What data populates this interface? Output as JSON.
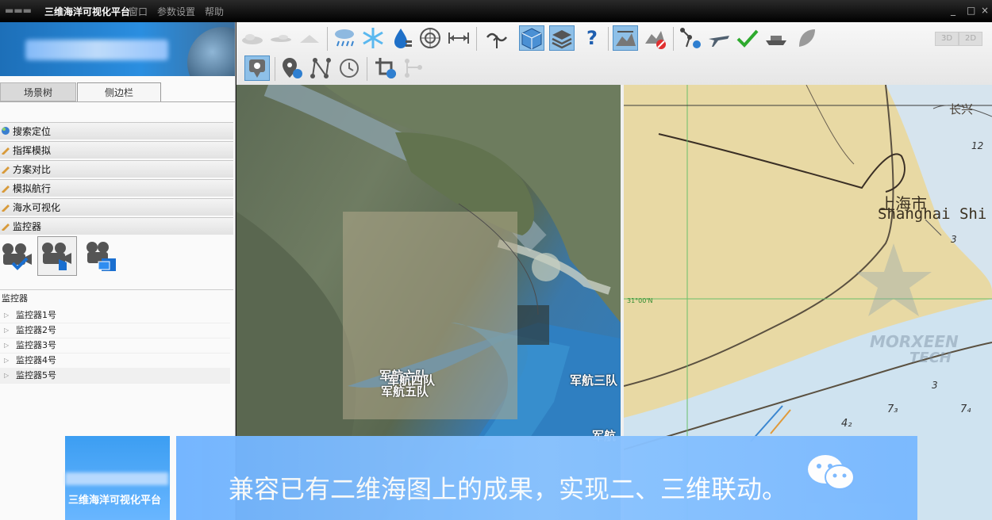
{
  "window": {
    "title": "三维海洋可视化平台",
    "menu": [
      "窗口",
      "参数设置",
      "帮助"
    ],
    "controls": [
      "_",
      "□",
      "×"
    ]
  },
  "sidebar": {
    "tabs": [
      "场景树",
      "侧边栏"
    ],
    "menu_items": [
      {
        "label": "搜索定位",
        "icon": "globe-search-icon"
      },
      {
        "label": "指挥模拟",
        "icon": "pencil-icon"
      },
      {
        "label": "方案对比",
        "icon": "pencil-icon"
      },
      {
        "label": "模拟航行",
        "icon": "pencil-icon"
      },
      {
        "label": "海水可视化",
        "icon": "pencil-icon"
      },
      {
        "label": "监控器",
        "icon": "pencil-icon"
      }
    ],
    "camera_buttons": [
      "camera-check-icon",
      "camera-hand-icon",
      "camera-window-icon"
    ],
    "monitor_header": "监控器",
    "monitors": [
      "监控器1号",
      "监控器2号",
      "监控器3号",
      "监控器4号",
      "监控器5号"
    ]
  },
  "toolbar": {
    "row1_icons": [
      "cloud-icon",
      "cloud-thin-icon",
      "cloud-low-icon",
      "rain-icon",
      "snow-icon",
      "water-level-icon",
      "radar-icon",
      "measure-distance-icon",
      "wave-arrow-icon",
      "cube-view-icon",
      "layers-icon",
      "help-icon",
      "terrain-icon",
      "no-terrain-icon",
      "route-settings-icon",
      "airplane-icon",
      "checkmark-icon",
      "ship-icon",
      "leaf-icon"
    ],
    "view_modes": [
      "3D",
      "2D"
    ],
    "row2_icons": [
      "marker-icon",
      "location-pin-icon",
      "network-node-icon",
      "clock-icon",
      "crop-icon",
      "branch-icon"
    ]
  },
  "map3d": {
    "labels": [
      "军航六队",
      "军航四队",
      "军航五队",
      "军航三队",
      "军航"
    ]
  },
  "chart2d": {
    "city_cn": "上海市",
    "city_en": "Shanghai Shi",
    "lat_label": "31°00'N",
    "place_cn": "长兴",
    "depths": [
      "12",
      "3",
      "3",
      "7₃",
      "7₄",
      "4₂"
    ],
    "watermark": [
      "MORXEEN",
      "TECH"
    ]
  },
  "subtitle": {
    "logo_text": "三维海洋可视化平台",
    "text": "兼容已有二维海图上的成果，实现二、三维联动。"
  },
  "colors": {
    "accent": "#2a8ee0",
    "toolbar_active": "#8ec0e8",
    "chart_land": "#e8d9a4",
    "chart_sea": "#cfe3f0"
  }
}
